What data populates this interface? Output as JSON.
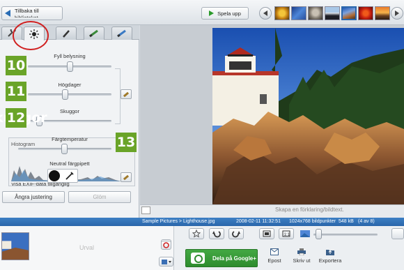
{
  "toolbar": {
    "back_label": "Tillbaka till",
    "back_label_line2": "biblioteket",
    "play_label": "Spela upp"
  },
  "thumbnails": [
    "sunflower-thumb",
    "blue-thumb",
    "koala-thumb",
    "penguins-thumb",
    "lighthouse-thumb",
    "red-flower-thumb",
    "sunset-thumb"
  ],
  "panel": {
    "tabs": [
      "tools-tab",
      "light-tab",
      "brush-tab",
      "color-tab",
      "effects-tab"
    ],
    "fill_light": {
      "label": "Fyll belysning",
      "value": 0.45
    },
    "highlights": {
      "label": "Högdager",
      "value": 0.42
    },
    "shadows": {
      "label": "Skuggor",
      "value": 0.05
    },
    "color_temp": {
      "label": "Färgtemperatur",
      "value": 0.48
    },
    "histogram_label": "Histogram",
    "neutral_picker_label": "Neutral färgpipett",
    "exif_label": "Visa EXIF-data tillgänglig",
    "undo_label": "Ångra justering",
    "clear_label": "Glöm",
    "badges": [
      "10",
      "11",
      "12",
      "13"
    ]
  },
  "photo": {
    "caption_placeholder": "Skapa en förklaring/bildtext."
  },
  "status": {
    "path": "Sample Pictures > Lighthouse.jpg",
    "date": "2008-02-11 11:32:51",
    "dimensions": "1024x768 bildpunkter",
    "size": "548 kB",
    "position": "(4 av 8)"
  },
  "bottom": {
    "tray_label": "Urval",
    "share_label": "Dela på Google+",
    "email_label": "Epost",
    "print_label": "Skriv ut",
    "export_label": "Exportera"
  },
  "colors": {
    "badge": "#6aa428",
    "status_bar": "#2a66aa",
    "share_button": "#2e8c2e",
    "highlight_circle": "#d02020"
  }
}
